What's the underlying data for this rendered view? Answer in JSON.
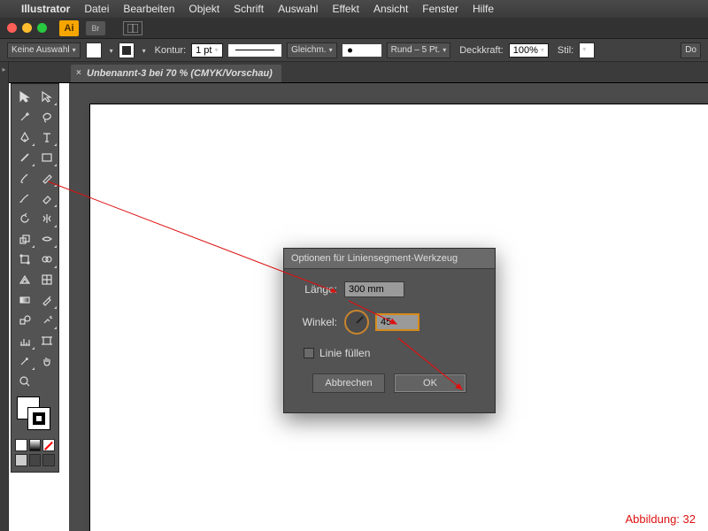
{
  "mac_menu": {
    "app_name": "Illustrator",
    "items": [
      "Datei",
      "Bearbeiten",
      "Objekt",
      "Schrift",
      "Auswahl",
      "Effekt",
      "Ansicht",
      "Fenster",
      "Hilfe"
    ]
  },
  "win": {
    "ai": "Ai",
    "br": "Br"
  },
  "control_bar": {
    "selection": "Keine Auswahl",
    "stroke_label": "Kontur:",
    "stroke_weight": "1 pt",
    "stroke_profile": "Gleichm.",
    "brush": "Rund – 5 Pt.",
    "opacity_label": "Deckkraft:",
    "opacity": "100%",
    "style_label": "Stil:",
    "doc_setup": "Do"
  },
  "tab": {
    "name": "Unbenannt-3 bei 70 % (CMYK/Vorschau)"
  },
  "dialog": {
    "title": "Optionen für Liniensegment-Werkzeug",
    "length_label": "Länge:",
    "length_value": "300 mm",
    "angle_label": "Winkel:",
    "angle_value": "45",
    "fill_label": "Linie füllen",
    "cancel": "Abbrechen",
    "ok": "OK"
  },
  "caption": "Abbildung: 32",
  "colors": {
    "accent": "#d11",
    "highlight": "#d68a1a"
  }
}
